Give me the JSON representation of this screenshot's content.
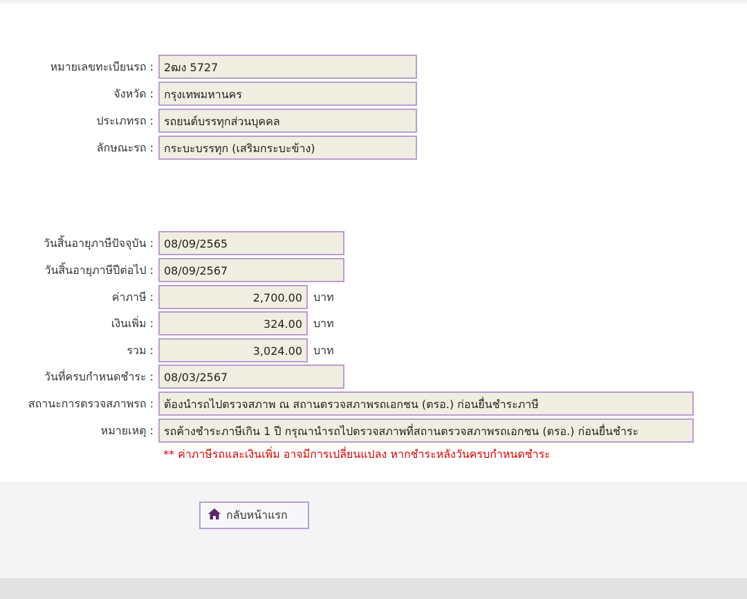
{
  "vehicle": {
    "plate_label": "หมายเลขทะเบียนรถ :",
    "plate_value": "2ฒง 5727",
    "province_label": "จังหวัด :",
    "province_value": "กรุงเทพมหานคร",
    "type_label": "ประเภทรถ :",
    "type_value": "รถยนต์บรรทุกส่วนบุคคล",
    "body_label": "ลักษณะรถ :",
    "body_value": "กระบะบรรทุก (เสริมกระบะข้าง)"
  },
  "tax": {
    "current_expiry_label": "วันสิ้นอายุภาษีปัจจุบัน :",
    "current_expiry_value": "08/09/2565",
    "next_expiry_label": "วันสิ้นอายุภาษีปีต่อไป :",
    "next_expiry_value": "08/09/2567",
    "tax_label": "ค่าภาษี :",
    "tax_value": "2,700.00",
    "surcharge_label": "เงินเพิ่ม :",
    "surcharge_value": "324.00",
    "total_label": "รวม :",
    "total_value": "3,024.00",
    "currency": "บาท",
    "due_label": "วันที่ครบกำหนดชำระ :",
    "due_value": "08/03/2567",
    "inspection_label": "สถานะการตรวจสภาพรถ :",
    "inspection_value": "ต้องนำรถไปตรวจสภาพ ณ สถานตรวจสภาพรถเอกชน (ตรอ.) ก่อนยื่นชำระภาษี",
    "remark_label": "หมายเหตุ :",
    "remark_value": "รถค้างชำระภาษีเกิน 1 ปี กรุณานำรถไปตรวจสภาพที่สถานตรวจสภาพรถเอกชน (ตรอ.) ก่อนยื่นชำระ",
    "warning": "** ค่าภาษีรถและเงินเพิ่ม อาจมีการเปลี่ยนแปลง หากชำระหลังวันครบกำหนดชำระ"
  },
  "actions": {
    "home_label": "กลับหน้าแรก",
    "home_icon": "home-icon"
  },
  "colors": {
    "field_bg": "#efeee0",
    "field_border": "#b89dd3",
    "warning": "#e00000"
  }
}
